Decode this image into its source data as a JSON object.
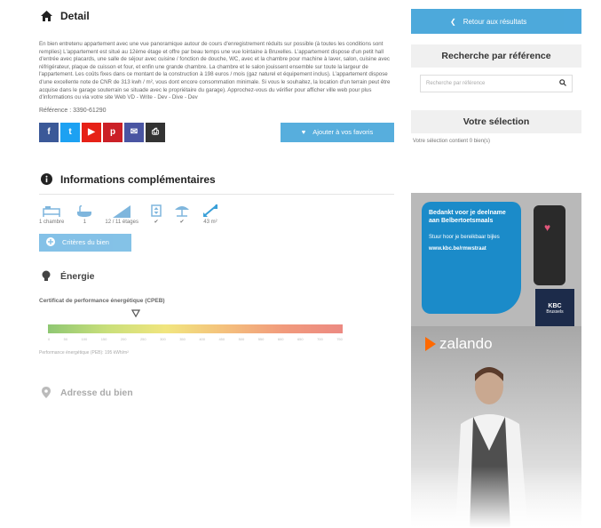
{
  "detail": {
    "title": "Detail",
    "description": "En bien entretenu appartement avec une vue panoramique autour de cours d'enregistrement réduits sur possible (à toutes les conditions sont remplies) L'appartement est situé au 12ème étage et offre par beau temps une vue lointaine à Bruxelles. L'appartement dispose d'un petit hall d'entrée avec placards, une salle de séjour avec cuisine / fonction de douche, WC, avec et la chambre pour machine à laver, salon, cuisine avec réfrigérateur, plaque de cuisson et four, et enfin une grande chambre. La chambre et le salon jouissent ensemble sur toute la largeur de l'appartement. Les coûts fixes dans ce montant de la construction à 198 euros / mois (gaz naturel et équipement inclus). L'appartement dispose d'une excellente note de CNR de 313 kwh / m², vous dont encore consommation minimale. Si vous le souhaitez, la location d'un terrain peut être acquise dans le garage souterrain se situade avec le propriétaire du garage). Approchez-vous du vérifier pour afficher ville web pour plus d'informations ou via votre site Web VD - Write - Dev - Dive - Dev",
    "reference": "Référence : 3390-61290",
    "share": [
      {
        "name": "facebook",
        "glyph": "f",
        "color": "#3b5998"
      },
      {
        "name": "twitter",
        "glyph": "t",
        "color": "#1da1f2"
      },
      {
        "name": "youtube",
        "glyph": "▶",
        "color": "#e62117"
      },
      {
        "name": "pinterest",
        "glyph": "p",
        "color": "#cb2027"
      },
      {
        "name": "email",
        "glyph": "✉",
        "color": "#4a55a2"
      },
      {
        "name": "print",
        "glyph": "⎙",
        "color": "#333333"
      }
    ],
    "favorite_label": "Ajouter à vos favoris"
  },
  "info": {
    "title": "Informations complémentaires",
    "features": [
      {
        "icon": "bed-icon",
        "label": "1 chambre"
      },
      {
        "icon": "bath-icon",
        "label": "1"
      },
      {
        "icon": "floor-icon",
        "label": "12 / 11 étages"
      },
      {
        "icon": "elevator-icon",
        "label": "✔"
      },
      {
        "icon": "terrace-icon",
        "label": "✔"
      },
      {
        "icon": "surface-icon",
        "label": "43 m²"
      }
    ],
    "criteria_label": "Critères du bien"
  },
  "energy": {
    "title": "Énergie",
    "label": "Certificat de performance énergétique (CPEB)",
    "ticks": [
      "0",
      "50",
      "100",
      "150",
      "200",
      "250",
      "300",
      "350",
      "400",
      "450",
      "500",
      "550",
      "600",
      "650",
      "700",
      "750"
    ],
    "footnote": "Performance énergétique (PEB): 195 kWh/m²"
  },
  "address": {
    "title": "Adresse du bien"
  },
  "sidebar": {
    "back_label": "Retour aux résultats",
    "search_title": "Recherche par référence",
    "search_placeholder": "Recherche par référence",
    "selection_title": "Votre sélection",
    "selection_text": "Votre sélection contient 0 bien(s)"
  },
  "ad": {
    "bubble_title": "Bedankt voor je deelname aan Belbertoetsmaals",
    "bubble_text": "Stuur hoor je bereikbaar bijles",
    "bubble_link": "www.kbc.be/rmwstraat",
    "bank": "KBC",
    "bank_city": "Brussels",
    "brand": "zalando"
  }
}
